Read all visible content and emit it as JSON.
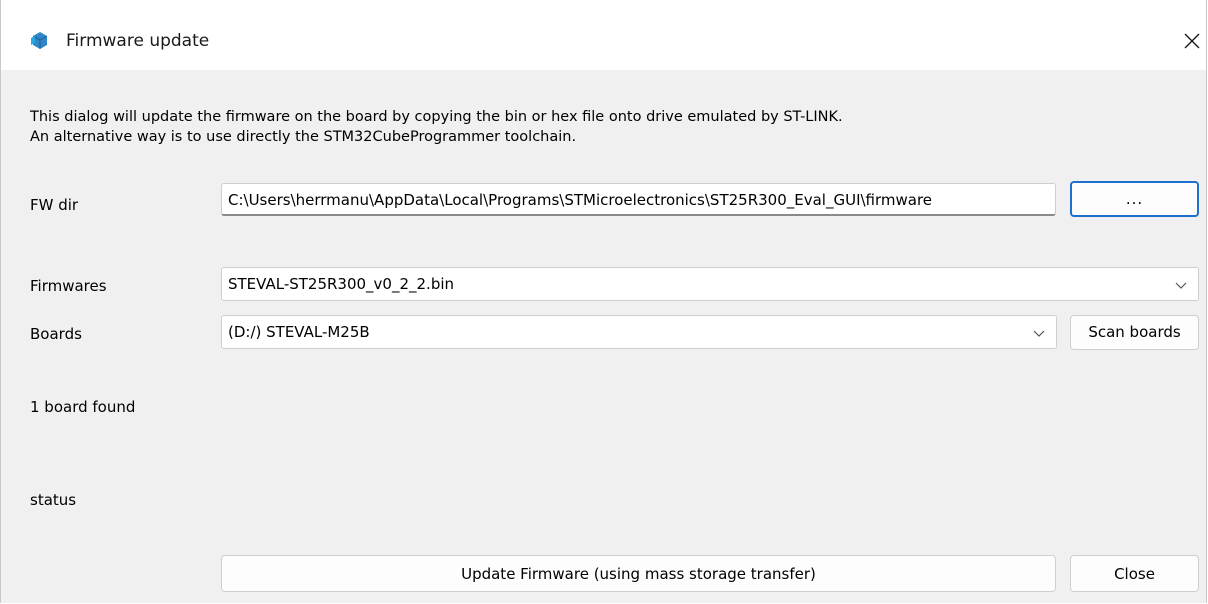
{
  "window": {
    "title": "Firmware update"
  },
  "description": {
    "line1": "This dialog will update the firmware on the board by copying the bin or hex file onto drive emulated by ST-LINK.",
    "line2": "An alternative way is to use directly the STM32CubeProgrammer toolchain."
  },
  "fw_dir": {
    "label": "FW dir",
    "value": "C:\\Users\\herrmanu\\AppData\\Local\\Programs\\STMicroelectronics\\ST25R300_Eval_GUI\\firmware",
    "browse_label": "..."
  },
  "firmwares": {
    "label": "Firmwares",
    "selected": "STEVAL-ST25R300_v0_2_2.bin"
  },
  "boards": {
    "label": "Boards",
    "selected": "(D:/) STEVAL-M25B",
    "scan_label": "Scan boards"
  },
  "board_count_text": "1 board found",
  "status_text": "status",
  "buttons": {
    "update_label": "Update Firmware (using mass storage transfer)",
    "close_label": "Close"
  },
  "icons": {
    "app": "app-cube-icon",
    "close": "close-icon",
    "dropdown": "chevron-down-icon"
  },
  "colors": {
    "accent": "#1f6fcf",
    "app_icon": "#2f86c8"
  }
}
